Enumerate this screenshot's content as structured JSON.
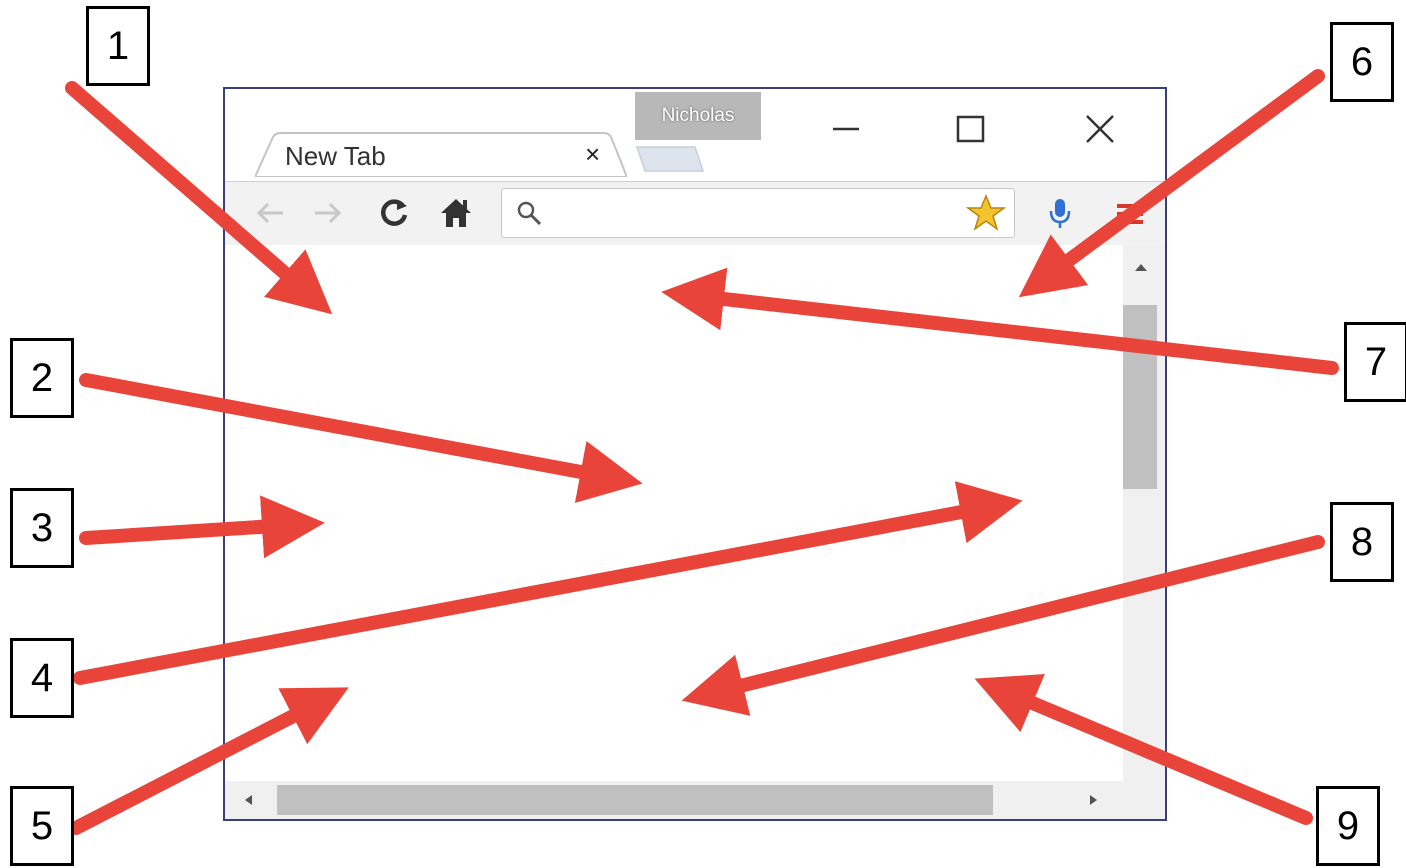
{
  "browser": {
    "tab": {
      "title": "New Tab",
      "close_glyph": "×"
    },
    "profile_name": "Nicholas",
    "window_controls": [
      "minimize-icon",
      "maximize-icon",
      "close-icon"
    ],
    "toolbar_icons": [
      "back-arrow-icon",
      "forward-arrow-icon",
      "reload-icon",
      "home-icon",
      "search-icon",
      "bookmark-star-icon",
      "microphone-icon",
      "menu-icon"
    ],
    "address_bar": {
      "value": "",
      "placeholder": ""
    },
    "scrollbars": [
      "vertical-scrollbar",
      "horizontal-scrollbar"
    ]
  },
  "callouts": [
    {
      "number": "1"
    },
    {
      "number": "2"
    },
    {
      "number": "3"
    },
    {
      "number": "4"
    },
    {
      "number": "5"
    },
    {
      "number": "6"
    },
    {
      "number": "7"
    },
    {
      "number": "8"
    },
    {
      "number": "9"
    }
  ],
  "colors": {
    "arrow": "#e8443a",
    "window_border": "#3a3f7a",
    "toolbar": "#f2f2f2",
    "star": "#f4c430",
    "mic": "#2f6fd6",
    "menu": "#d9362b"
  }
}
